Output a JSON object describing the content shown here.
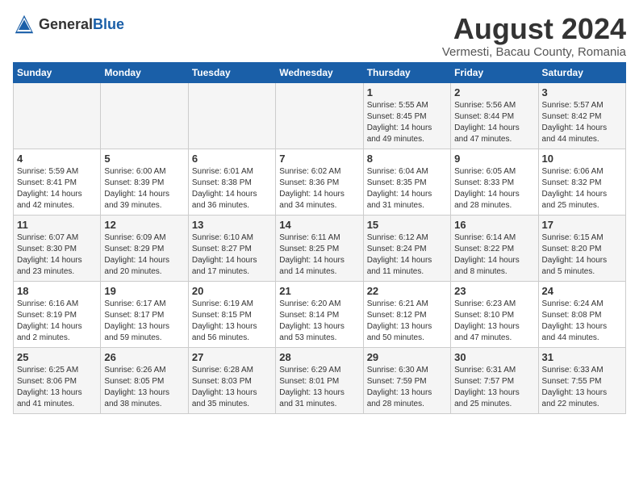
{
  "logo": {
    "general": "General",
    "blue": "Blue"
  },
  "title": "August 2024",
  "subtitle": "Vermesti, Bacau County, Romania",
  "days_of_week": [
    "Sunday",
    "Monday",
    "Tuesday",
    "Wednesday",
    "Thursday",
    "Friday",
    "Saturday"
  ],
  "weeks": [
    [
      {
        "day": "",
        "info": ""
      },
      {
        "day": "",
        "info": ""
      },
      {
        "day": "",
        "info": ""
      },
      {
        "day": "",
        "info": ""
      },
      {
        "day": "1",
        "info": "Sunrise: 5:55 AM\nSunset: 8:45 PM\nDaylight: 14 hours\nand 49 minutes."
      },
      {
        "day": "2",
        "info": "Sunrise: 5:56 AM\nSunset: 8:44 PM\nDaylight: 14 hours\nand 47 minutes."
      },
      {
        "day": "3",
        "info": "Sunrise: 5:57 AM\nSunset: 8:42 PM\nDaylight: 14 hours\nand 44 minutes."
      }
    ],
    [
      {
        "day": "4",
        "info": "Sunrise: 5:59 AM\nSunset: 8:41 PM\nDaylight: 14 hours\nand 42 minutes."
      },
      {
        "day": "5",
        "info": "Sunrise: 6:00 AM\nSunset: 8:39 PM\nDaylight: 14 hours\nand 39 minutes."
      },
      {
        "day": "6",
        "info": "Sunrise: 6:01 AM\nSunset: 8:38 PM\nDaylight: 14 hours\nand 36 minutes."
      },
      {
        "day": "7",
        "info": "Sunrise: 6:02 AM\nSunset: 8:36 PM\nDaylight: 14 hours\nand 34 minutes."
      },
      {
        "day": "8",
        "info": "Sunrise: 6:04 AM\nSunset: 8:35 PM\nDaylight: 14 hours\nand 31 minutes."
      },
      {
        "day": "9",
        "info": "Sunrise: 6:05 AM\nSunset: 8:33 PM\nDaylight: 14 hours\nand 28 minutes."
      },
      {
        "day": "10",
        "info": "Sunrise: 6:06 AM\nSunset: 8:32 PM\nDaylight: 14 hours\nand 25 minutes."
      }
    ],
    [
      {
        "day": "11",
        "info": "Sunrise: 6:07 AM\nSunset: 8:30 PM\nDaylight: 14 hours\nand 23 minutes."
      },
      {
        "day": "12",
        "info": "Sunrise: 6:09 AM\nSunset: 8:29 PM\nDaylight: 14 hours\nand 20 minutes."
      },
      {
        "day": "13",
        "info": "Sunrise: 6:10 AM\nSunset: 8:27 PM\nDaylight: 14 hours\nand 17 minutes."
      },
      {
        "day": "14",
        "info": "Sunrise: 6:11 AM\nSunset: 8:25 PM\nDaylight: 14 hours\nand 14 minutes."
      },
      {
        "day": "15",
        "info": "Sunrise: 6:12 AM\nSunset: 8:24 PM\nDaylight: 14 hours\nand 11 minutes."
      },
      {
        "day": "16",
        "info": "Sunrise: 6:14 AM\nSunset: 8:22 PM\nDaylight: 14 hours\nand 8 minutes."
      },
      {
        "day": "17",
        "info": "Sunrise: 6:15 AM\nSunset: 8:20 PM\nDaylight: 14 hours\nand 5 minutes."
      }
    ],
    [
      {
        "day": "18",
        "info": "Sunrise: 6:16 AM\nSunset: 8:19 PM\nDaylight: 14 hours\nand 2 minutes."
      },
      {
        "day": "19",
        "info": "Sunrise: 6:17 AM\nSunset: 8:17 PM\nDaylight: 13 hours\nand 59 minutes."
      },
      {
        "day": "20",
        "info": "Sunrise: 6:19 AM\nSunset: 8:15 PM\nDaylight: 13 hours\nand 56 minutes."
      },
      {
        "day": "21",
        "info": "Sunrise: 6:20 AM\nSunset: 8:14 PM\nDaylight: 13 hours\nand 53 minutes."
      },
      {
        "day": "22",
        "info": "Sunrise: 6:21 AM\nSunset: 8:12 PM\nDaylight: 13 hours\nand 50 minutes."
      },
      {
        "day": "23",
        "info": "Sunrise: 6:23 AM\nSunset: 8:10 PM\nDaylight: 13 hours\nand 47 minutes."
      },
      {
        "day": "24",
        "info": "Sunrise: 6:24 AM\nSunset: 8:08 PM\nDaylight: 13 hours\nand 44 minutes."
      }
    ],
    [
      {
        "day": "25",
        "info": "Sunrise: 6:25 AM\nSunset: 8:06 PM\nDaylight: 13 hours\nand 41 minutes."
      },
      {
        "day": "26",
        "info": "Sunrise: 6:26 AM\nSunset: 8:05 PM\nDaylight: 13 hours\nand 38 minutes."
      },
      {
        "day": "27",
        "info": "Sunrise: 6:28 AM\nSunset: 8:03 PM\nDaylight: 13 hours\nand 35 minutes."
      },
      {
        "day": "28",
        "info": "Sunrise: 6:29 AM\nSunset: 8:01 PM\nDaylight: 13 hours\nand 31 minutes."
      },
      {
        "day": "29",
        "info": "Sunrise: 6:30 AM\nSunset: 7:59 PM\nDaylight: 13 hours\nand 28 minutes."
      },
      {
        "day": "30",
        "info": "Sunrise: 6:31 AM\nSunset: 7:57 PM\nDaylight: 13 hours\nand 25 minutes."
      },
      {
        "day": "31",
        "info": "Sunrise: 6:33 AM\nSunset: 7:55 PM\nDaylight: 13 hours\nand 22 minutes."
      }
    ]
  ]
}
